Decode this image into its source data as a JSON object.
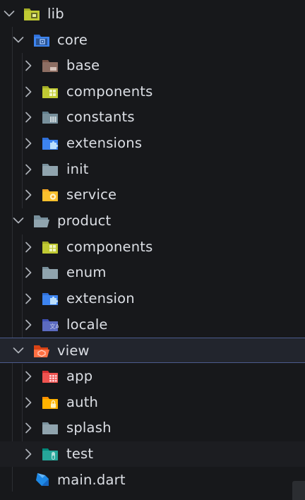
{
  "tree": [
    {
      "label": "lib",
      "depth": 0,
      "type": "folder",
      "expanded": true,
      "icon": "lib-folder-icon"
    },
    {
      "label": "core",
      "depth": 1,
      "type": "folder",
      "expanded": true,
      "icon": "core-folder-icon"
    },
    {
      "label": "base",
      "depth": 2,
      "type": "folder",
      "expanded": false,
      "icon": "base-folder-icon"
    },
    {
      "label": "components",
      "depth": 2,
      "type": "folder",
      "expanded": false,
      "icon": "components-folder-icon"
    },
    {
      "label": "constants",
      "depth": 2,
      "type": "folder",
      "expanded": false,
      "icon": "constants-folder-icon"
    },
    {
      "label": "extensions",
      "depth": 2,
      "type": "folder",
      "expanded": false,
      "icon": "extensions-folder-icon"
    },
    {
      "label": "init",
      "depth": 2,
      "type": "folder",
      "expanded": false,
      "icon": "folder-icon"
    },
    {
      "label": "service",
      "depth": 2,
      "type": "folder",
      "expanded": false,
      "icon": "service-folder-icon"
    },
    {
      "label": "product",
      "depth": 1,
      "type": "folder",
      "expanded": true,
      "icon": "open-folder-icon"
    },
    {
      "label": "components",
      "depth": 2,
      "type": "folder",
      "expanded": false,
      "icon": "components-folder-icon"
    },
    {
      "label": "enum",
      "depth": 2,
      "type": "folder",
      "expanded": false,
      "icon": "folder-icon"
    },
    {
      "label": "extension",
      "depth": 2,
      "type": "folder",
      "expanded": false,
      "icon": "extensions-folder-icon"
    },
    {
      "label": "locale",
      "depth": 2,
      "type": "folder",
      "expanded": false,
      "icon": "locale-folder-icon"
    },
    {
      "label": "view",
      "depth": 1,
      "type": "folder",
      "expanded": true,
      "selected": true,
      "icon": "view-folder-icon"
    },
    {
      "label": "app",
      "depth": 2,
      "type": "folder",
      "expanded": false,
      "icon": "app-folder-icon"
    },
    {
      "label": "auth",
      "depth": 2,
      "type": "folder",
      "expanded": false,
      "icon": "auth-folder-icon"
    },
    {
      "label": "splash",
      "depth": 2,
      "type": "folder",
      "expanded": false,
      "icon": "folder-icon"
    },
    {
      "label": "test",
      "depth": 2,
      "type": "folder",
      "expanded": false,
      "hovered": true,
      "icon": "test-folder-icon"
    },
    {
      "label": "main.dart",
      "depth": 1,
      "type": "file",
      "icon": "dart-file-icon"
    }
  ],
  "colors": {
    "background": "#17181b",
    "selected_background": "#22252d",
    "selected_border": "#4c5b8d",
    "text": "#dcdfe5",
    "chevron": "#aeb2b9"
  }
}
